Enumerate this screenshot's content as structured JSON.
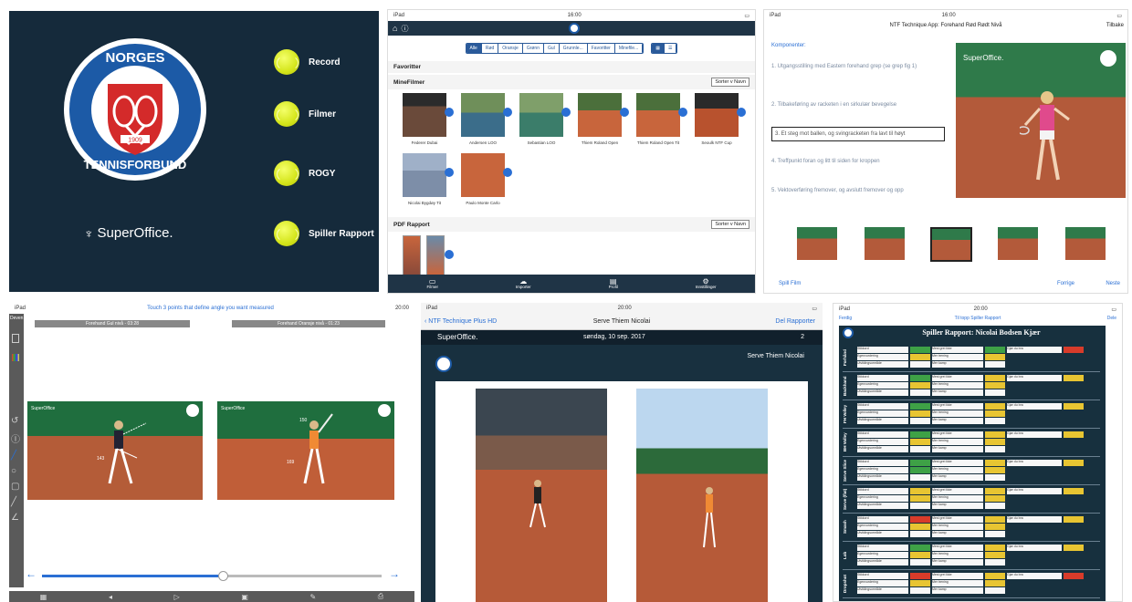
{
  "panel1": {
    "logo": {
      "top_text": "NORGES",
      "bottom_text": "TENNISFORBUND",
      "year": "1909"
    },
    "brand": "SuperOffice.",
    "menu": [
      {
        "label": "Record",
        "icon": "tennis-ball-icon"
      },
      {
        "label": "Filmer",
        "icon": "tennis-ball-icon"
      },
      {
        "label": "ROGY",
        "icon": "tennis-ball-icon"
      },
      {
        "label": "Spiller Rapport",
        "icon": "tennis-ball-icon"
      }
    ]
  },
  "panel2": {
    "status_left": "iPad",
    "status_time": "16:00",
    "filters": [
      "Alle",
      "Rød",
      "Oransje",
      "Grønn",
      "Gul",
      "Grunnle...",
      "Favoritter",
      "Minefile..."
    ],
    "sections": {
      "favoritter": "Favoritter",
      "mine_filmer": "MineFilmer",
      "pdf": "PDF Rapport"
    },
    "sort_label": "Sorter v Navn",
    "videos": [
      "Federer Dubai",
      "Andersen LOO",
      "Sebastian LOO",
      "Thiem Roland Open",
      "Thiem Roland Open Tit",
      "Seoulk NTF Cup",
      "Nicolai Bygdøy Tit",
      "Paulo Monte Carlo"
    ],
    "tabbar": [
      "Filmer",
      "Importer",
      "Profil",
      "Innstillinger"
    ]
  },
  "panel3": {
    "status_left": "iPad",
    "status_time": "16:00",
    "title": "NTF Technique App: Forehand Rød Rødt Nivå",
    "back": "Tilbake",
    "components_title": "Komponenter:",
    "components": [
      "1. Utgangsstilling med Eastern forehand grep (se grep fig 1)",
      "2. Tilbakeføring av racketen i en sirkulær bevegelse",
      "3. Et steg mot ballen, og svingracketen fra lavt til høyt",
      "4. Treffpunkt foran og litt til siden for kroppen",
      "5. Vektoverføring fremover, og avslutt fremover og opp"
    ],
    "brand": "SuperOffice.",
    "footer_left": "Spill Film",
    "footer_prev": "Forrige",
    "footer_next": "Neste"
  },
  "panel4": {
    "status_left": "iPad",
    "hint": "Touch 3 points that define angle you want measured",
    "status_time": "20:00",
    "labels": [
      "Forehand Gul nivå - 03:28",
      "Forehand Oransje nivå - 01:23"
    ],
    "side_label": "Deven",
    "brand": "SuperOffice",
    "angles": [
      "143",
      "150",
      "169"
    ]
  },
  "panel5": {
    "status_left": "iPad",
    "status_time": "20:00",
    "back": "NTF Technique Plus HD",
    "title": "Serve Thiem Nicolai",
    "action": "Del Rapporter",
    "brand": "SuperOffice.",
    "date": "søndag, 10 sep. 2017",
    "page": "2",
    "subtitle": "Serve Thiem Nicolai"
  },
  "panel6": {
    "status_left": "iPad",
    "status_time": "20:00",
    "left": "Ferdig",
    "center": "Til topp Spiller Rapport",
    "right": "Dele",
    "title": "Spiller Rapport: Nicolai Bodsen Kjær",
    "groups": [
      "Forhånd",
      "Backhand",
      "FH Volley",
      "BH Volley",
      "Serve Slice",
      "Serve (flat)",
      "Smash",
      "Lob",
      "Dropshot"
    ],
    "row_labels": [
      "Stikkord",
      "Egenvurdering",
      "Utviklingsområde"
    ],
    "mid_labels": [
      "Mest grei ikke",
      "Mer trening",
      "Mer kamp"
    ],
    "right_label": "Gjør du bra",
    "colors": {
      "green": "#3ea146",
      "red": "#d83b2a",
      "yellow": "#e8c532"
    }
  }
}
